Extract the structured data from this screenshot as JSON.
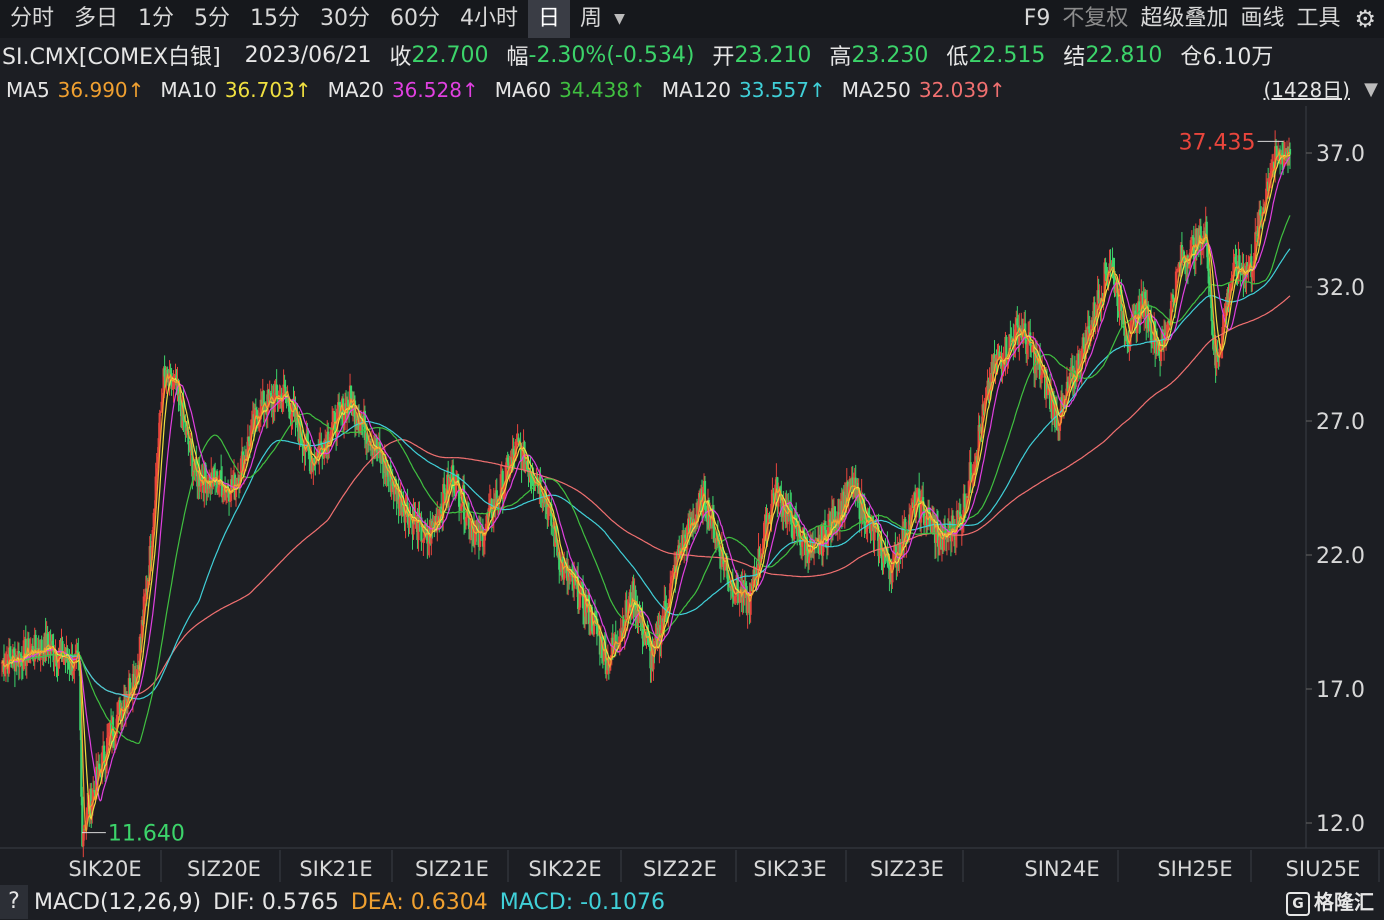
{
  "toolbar": {
    "items": [
      "分时",
      "多日",
      "1分",
      "5分",
      "15分",
      "30分",
      "60分",
      "4小时",
      "日",
      "周"
    ],
    "active_index": 8,
    "more_icon": "caret-down-icon",
    "right": {
      "f9": "F9",
      "fuquan": "不复权",
      "overlay": "超级叠加",
      "draw": "画线",
      "tools": "工具",
      "settings_icon": "gear-icon"
    }
  },
  "info": {
    "symbol": "SI.CMX[COMEX白银]",
    "date": "2023/06/21",
    "close_label": "收",
    "close": "22.700",
    "change_label": "幅",
    "change": "-2.30%(-0.534)",
    "open_label": "开",
    "open": "23.210",
    "high_label": "高",
    "high": "23.230",
    "low_label": "低",
    "low": "22.515",
    "settle_label": "结",
    "settle": "22.810",
    "oi_label": "仓",
    "oi": "6.10万"
  },
  "ma": {
    "items": [
      {
        "label": "MA5",
        "value": "36.990↑",
        "color": "#f0a030"
      },
      {
        "label": "MA10",
        "value": "36.703↑",
        "color": "#f0e040"
      },
      {
        "label": "MA20",
        "value": "36.528↑",
        "color": "#e040e0"
      },
      {
        "label": "MA60",
        "value": "34.438↑",
        "color": "#40c040"
      },
      {
        "label": "MA120",
        "value": "33.557↑",
        "color": "#40d0d8"
      },
      {
        "label": "MA250",
        "value": "32.039↑",
        "color": "#f07070"
      }
    ],
    "period": "(1428日)",
    "dropdown_icon": "triangle-down-icon"
  },
  "chart_data": {
    "type": "candlestick",
    "y_ticks": [
      "37.0",
      "32.0",
      "27.0",
      "22.0",
      "17.0",
      "12.0"
    ],
    "ylim": [
      11,
      38.2
    ],
    "x_labels": [
      "SIK20E",
      "SIZ20E",
      "SIK21E",
      "SIZ21E",
      "SIK22E",
      "SIZ22E",
      "SIK23E",
      "SIZ23E",
      "SIN24E",
      "SIH25E",
      "SIU25E"
    ],
    "max_label": "37.435",
    "min_label": "11.640",
    "series_colors": {
      "up": "#e8453c",
      "down": "#3cd46a",
      "ma5": "#f0a030",
      "ma10": "#f0e040",
      "ma20": "#e040e0",
      "ma60": "#40c040",
      "ma120": "#40d0d8",
      "ma250": "#f07070"
    },
    "key_points": [
      {
        "x": 0.0,
        "y": 18.0
      },
      {
        "x": 0.035,
        "y": 18.6
      },
      {
        "x": 0.06,
        "y": 17.8
      },
      {
        "x": 0.062,
        "y": 11.64
      },
      {
        "x": 0.085,
        "y": 15.5
      },
      {
        "x": 0.105,
        "y": 17.8
      },
      {
        "x": 0.115,
        "y": 22.0
      },
      {
        "x": 0.125,
        "y": 28.5
      },
      {
        "x": 0.135,
        "y": 28.2
      },
      {
        "x": 0.15,
        "y": 25.0
      },
      {
        "x": 0.18,
        "y": 24.5
      },
      {
        "x": 0.2,
        "y": 27.5
      },
      {
        "x": 0.22,
        "y": 28.0
      },
      {
        "x": 0.24,
        "y": 25.5
      },
      {
        "x": 0.27,
        "y": 27.8
      },
      {
        "x": 0.285,
        "y": 26.5
      },
      {
        "x": 0.31,
        "y": 24.0
      },
      {
        "x": 0.33,
        "y": 22.5
      },
      {
        "x": 0.35,
        "y": 25.0
      },
      {
        "x": 0.37,
        "y": 22.5
      },
      {
        "x": 0.4,
        "y": 26.0
      },
      {
        "x": 0.42,
        "y": 24.5
      },
      {
        "x": 0.435,
        "y": 21.5
      },
      {
        "x": 0.455,
        "y": 20.0
      },
      {
        "x": 0.47,
        "y": 18.0
      },
      {
        "x": 0.49,
        "y": 20.5
      },
      {
        "x": 0.505,
        "y": 18.0
      },
      {
        "x": 0.525,
        "y": 22.0
      },
      {
        "x": 0.545,
        "y": 24.2
      },
      {
        "x": 0.565,
        "y": 21.0
      },
      {
        "x": 0.58,
        "y": 20.2
      },
      {
        "x": 0.6,
        "y": 24.5
      },
      {
        "x": 0.615,
        "y": 23.0
      },
      {
        "x": 0.63,
        "y": 22.0
      },
      {
        "x": 0.66,
        "y": 24.5
      },
      {
        "x": 0.69,
        "y": 21.5
      },
      {
        "x": 0.71,
        "y": 24.0
      },
      {
        "x": 0.73,
        "y": 22.5
      },
      {
        "x": 0.745,
        "y": 23.5
      },
      {
        "x": 0.77,
        "y": 29.0
      },
      {
        "x": 0.79,
        "y": 30.5
      },
      {
        "x": 0.805,
        "y": 29.0
      },
      {
        "x": 0.82,
        "y": 27.0
      },
      {
        "x": 0.845,
        "y": 30.5
      },
      {
        "x": 0.86,
        "y": 33.0
      },
      {
        "x": 0.875,
        "y": 30.0
      },
      {
        "x": 0.885,
        "y": 31.5
      },
      {
        "x": 0.9,
        "y": 29.5
      },
      {
        "x": 0.915,
        "y": 33.0
      },
      {
        "x": 0.935,
        "y": 34.0
      },
      {
        "x": 0.942,
        "y": 29.0
      },
      {
        "x": 0.955,
        "y": 32.5
      },
      {
        "x": 0.97,
        "y": 32.8
      },
      {
        "x": 0.985,
        "y": 36.5
      },
      {
        "x": 1.0,
        "y": 37.2
      }
    ]
  },
  "bottom": {
    "help": "?",
    "macd_label": "MACD(12,26,9)",
    "dif": "DIF: 0.5765",
    "dea": "DEA: 0.6304",
    "macd": "MACD: -0.1076",
    "logo_text": "格隆汇",
    "logo_icon": "gelonghui-logo-icon"
  }
}
